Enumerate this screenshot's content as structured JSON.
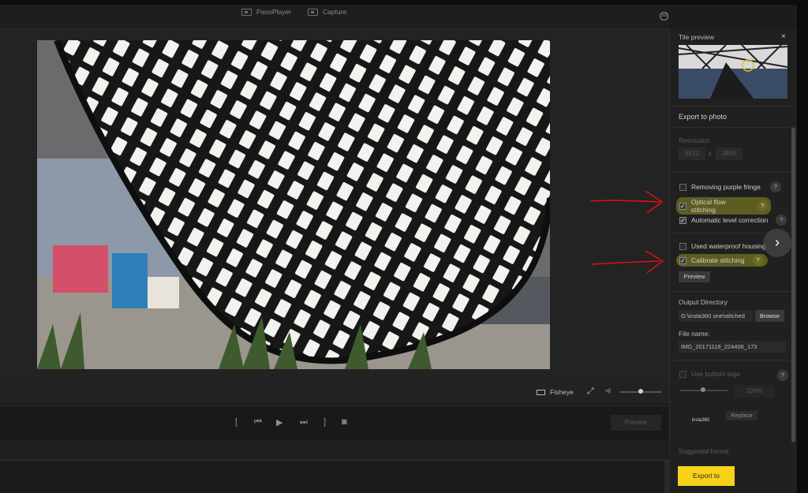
{
  "topbar": {
    "tabs": [
      {
        "label": "PanoPlayer",
        "icon": "panoplayer-icon"
      },
      {
        "label": "Capture",
        "icon": "capture-icon"
      }
    ],
    "mode_icon": "360"
  },
  "viewer": {
    "view_mode_label": "Fisheye"
  },
  "playback": {
    "preview_label": "Preview"
  },
  "right_panel": {
    "tile_preview_title": "Tile preview",
    "close_glyph": "×",
    "export_section_title": "Export to photo",
    "resolution_label": "Resolution",
    "resolution_width": "6912",
    "resolution_sep": "X",
    "resolution_height": "3456",
    "options": [
      {
        "label": "Removing purple fringe",
        "checked": false,
        "help": "?"
      },
      {
        "label": "Optical flow stitching",
        "checked": true,
        "help": "?",
        "highlighted": true
      },
      {
        "label": "Automatic level correction",
        "checked": true,
        "help": "?"
      },
      {
        "label": "Used waterproof housing",
        "checked": false
      },
      {
        "label": "Calibrate stitching",
        "checked": true,
        "help": "?",
        "highlighted": true
      }
    ],
    "preview_button": "Preview",
    "output_dir_label": "Output Directory",
    "output_dir_value": "G:\\insta360 one\\stitched",
    "browse_button": "Browse",
    "file_name_label": "File name:",
    "file_name_value": "IMG_20171119_224406_173",
    "bottom_logo_label": "Use bottom logo",
    "logo_help": "?",
    "logo_size": "100%",
    "logo_text": "insta360",
    "replace_button": "Replace",
    "suggested_format_label": "Suggested format:",
    "export_button": "Export to"
  },
  "colors": {
    "accent": "#f6d21a",
    "annotation": "#e01010",
    "highlight": "#c8c828"
  }
}
